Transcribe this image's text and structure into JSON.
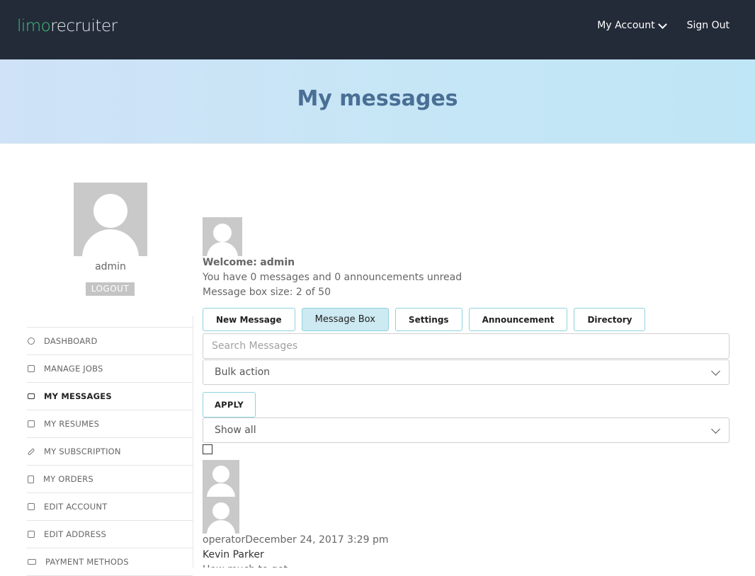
{
  "header": {
    "logo_part1": "limo",
    "logo_part2": "recruiter",
    "my_account": "My Account",
    "sign_out": "Sign Out"
  },
  "banner": {
    "title": "My messages"
  },
  "sidebar": {
    "username": "admin",
    "logout": "LOGOUT",
    "items": [
      {
        "label": "DASHBOARD",
        "icon": "dashboard-icon"
      },
      {
        "label": "MANAGE JOBS",
        "icon": "document-icon"
      },
      {
        "label": "MY MESSAGES",
        "icon": "envelope-icon",
        "active": true
      },
      {
        "label": "MY RESUMES",
        "icon": "copy-icon"
      },
      {
        "label": "MY SUBSCRIPTION",
        "icon": "pencil-icon"
      },
      {
        "label": "MY ORDERS",
        "icon": "file-icon"
      },
      {
        "label": "EDIT ACCOUNT",
        "icon": "edit-icon"
      },
      {
        "label": "EDIT ADDRESS",
        "icon": "edit-icon"
      },
      {
        "label": "PAYMENT METHODS",
        "icon": "money-icon"
      }
    ]
  },
  "main": {
    "welcome_label": "Welcome:",
    "welcome_user": "admin",
    "unread_text": "You have 0 messages and 0 announcements unread",
    "box_size_text": "Message box size: 2 of 50",
    "tabs": [
      {
        "label": "New Message"
      },
      {
        "label": "Message Box",
        "active": true
      },
      {
        "label": "Settings"
      },
      {
        "label": "Announcement"
      },
      {
        "label": "Directory"
      }
    ],
    "search_placeholder": "Search Messages",
    "bulk_action": "Bulk action",
    "apply": "APPLY",
    "filter": "Show all",
    "message": {
      "meta": "operatorDecember 24, 2017 3:29 pm",
      "sender": "Kevin Parker",
      "snippet": "How much to get"
    }
  }
}
